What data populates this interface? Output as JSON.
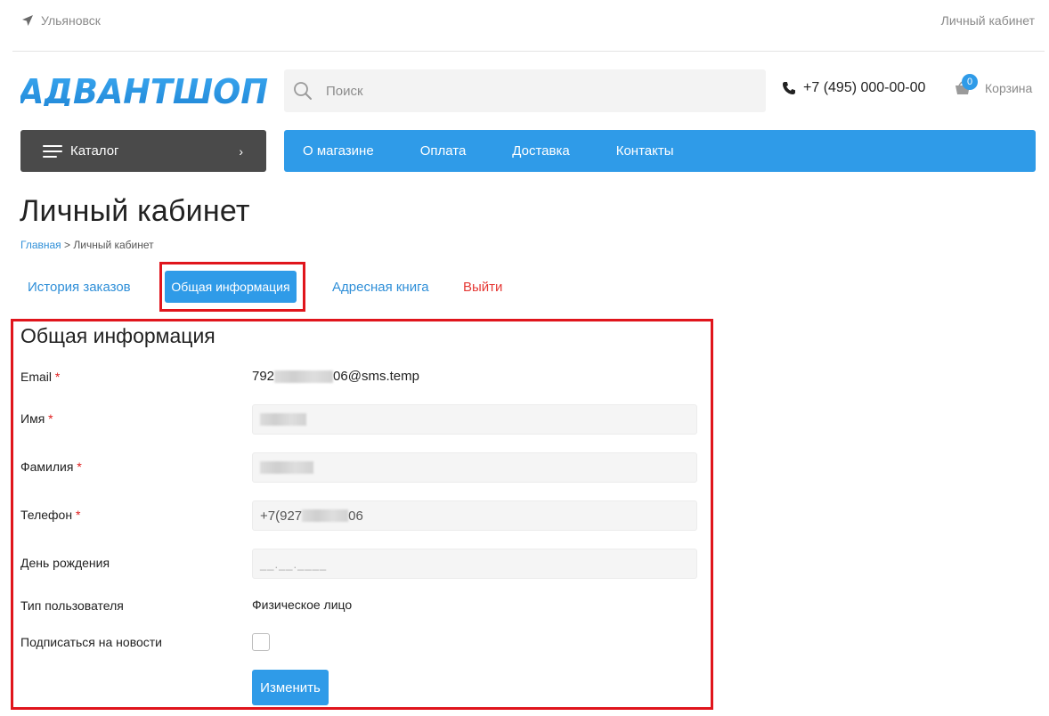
{
  "topbar": {
    "city": "Ульяновск",
    "city_icon": "location-arrow-icon",
    "account_link": "Личный кабинет"
  },
  "header": {
    "logo_text": "АДВАНТШОП",
    "search_placeholder": "Поиск",
    "phone": "+7 (495) 000-00-00",
    "cart_count": "0",
    "cart_label": "Корзина"
  },
  "nav": {
    "catalog_label": "Каталог",
    "catalog_chevron": "›",
    "menu_items": [
      "О магазине",
      "Оплата",
      "Доставка",
      "Контакты"
    ]
  },
  "page": {
    "title": "Личный кабинет",
    "breadcrumb_home": "Главная",
    "breadcrumb_sep": " > ",
    "breadcrumb_current": "Личный кабинет"
  },
  "tabs": {
    "orders": "История заказов",
    "general": "Общая информация",
    "addresses": "Адресная книга",
    "logout": "Выйти"
  },
  "form": {
    "title": "Общая информация",
    "email_label": "Email",
    "email_prefix": "792",
    "email_suffix": "06@sms.temp",
    "name_label": "Имя",
    "surname_label": "Фамилия",
    "phone_label": "Телефон",
    "phone_prefix": "+7(927",
    "phone_suffix": "06",
    "birthday_label": "День рождения",
    "birthday_placeholder": "__.__.____",
    "user_type_label": "Тип пользователя",
    "user_type_value": "Физическое лицо",
    "subscribe_label": "Подписаться на новости",
    "subscribe_checked": false,
    "required_mark": "*",
    "submit_label": "Изменить"
  },
  "colors": {
    "accent": "#2f9be8",
    "catalog_bg": "#4a4a4a",
    "link": "#2f8fd8",
    "logout": "#e53935",
    "highlight": "#e0151c"
  }
}
